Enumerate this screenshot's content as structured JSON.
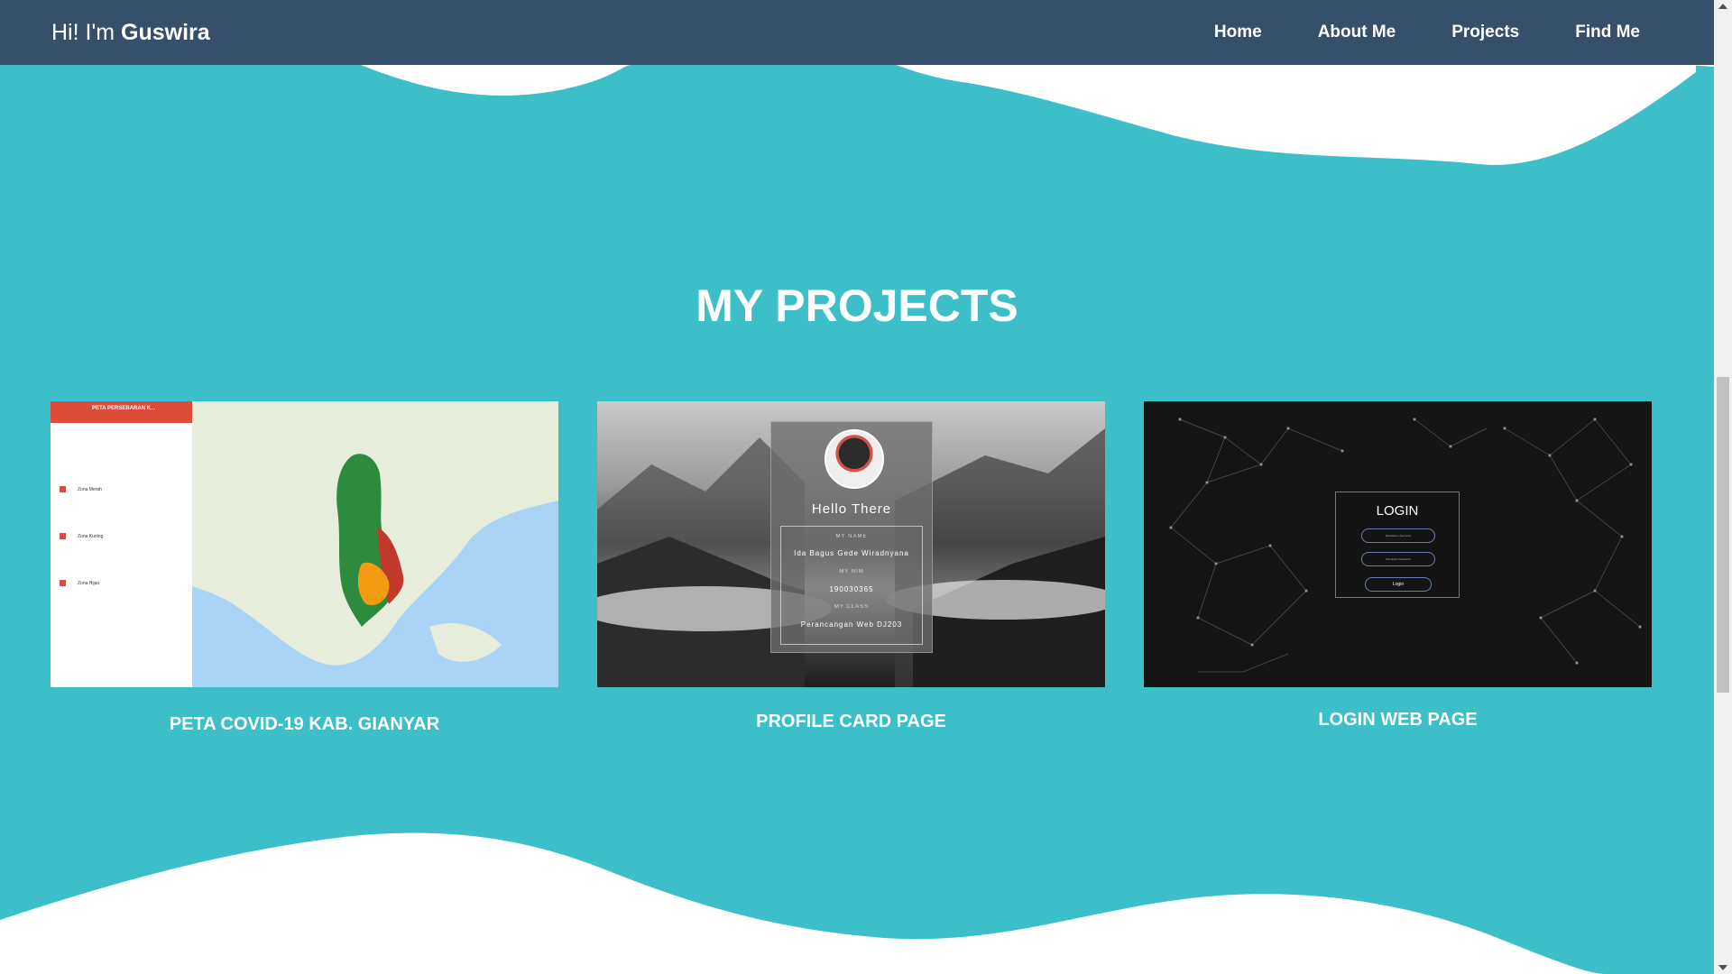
{
  "navbar": {
    "brand_prefix": "Hi! I'm ",
    "brand_name": "Guswira",
    "links": [
      "Home",
      "About Me",
      "Projects",
      "Find Me"
    ]
  },
  "section_title": "MY PROJECTS",
  "projects": [
    {
      "caption": "PETA COVID-19 KAB. GIANYAR",
      "map_header": "PETA PERSEBARAN K...",
      "map_zones": [
        "Zona Merah",
        "Zona Kuning",
        "Zona Hijau"
      ]
    },
    {
      "caption": "PROFILE CARD PAGE",
      "greeting": "Hello There",
      "fields": [
        {
          "label": "MY NAME",
          "value": "Ida Bagus Gede Wiradnyana"
        },
        {
          "label": "MY NIM",
          "value": "190030365"
        },
        {
          "label": "MY CLASS",
          "value": "Perancangan Web DJ203"
        }
      ]
    },
    {
      "caption": "LOGIN WEB PAGE",
      "login_title": "LOGIN",
      "username_placeholder": "Masukkan Username",
      "password_placeholder": "Masukkan Password",
      "button_label": "Login"
    }
  ],
  "colors": {
    "navbar": "#364f6b",
    "background": "#3cbfc8",
    "wave": "#ffffff"
  }
}
